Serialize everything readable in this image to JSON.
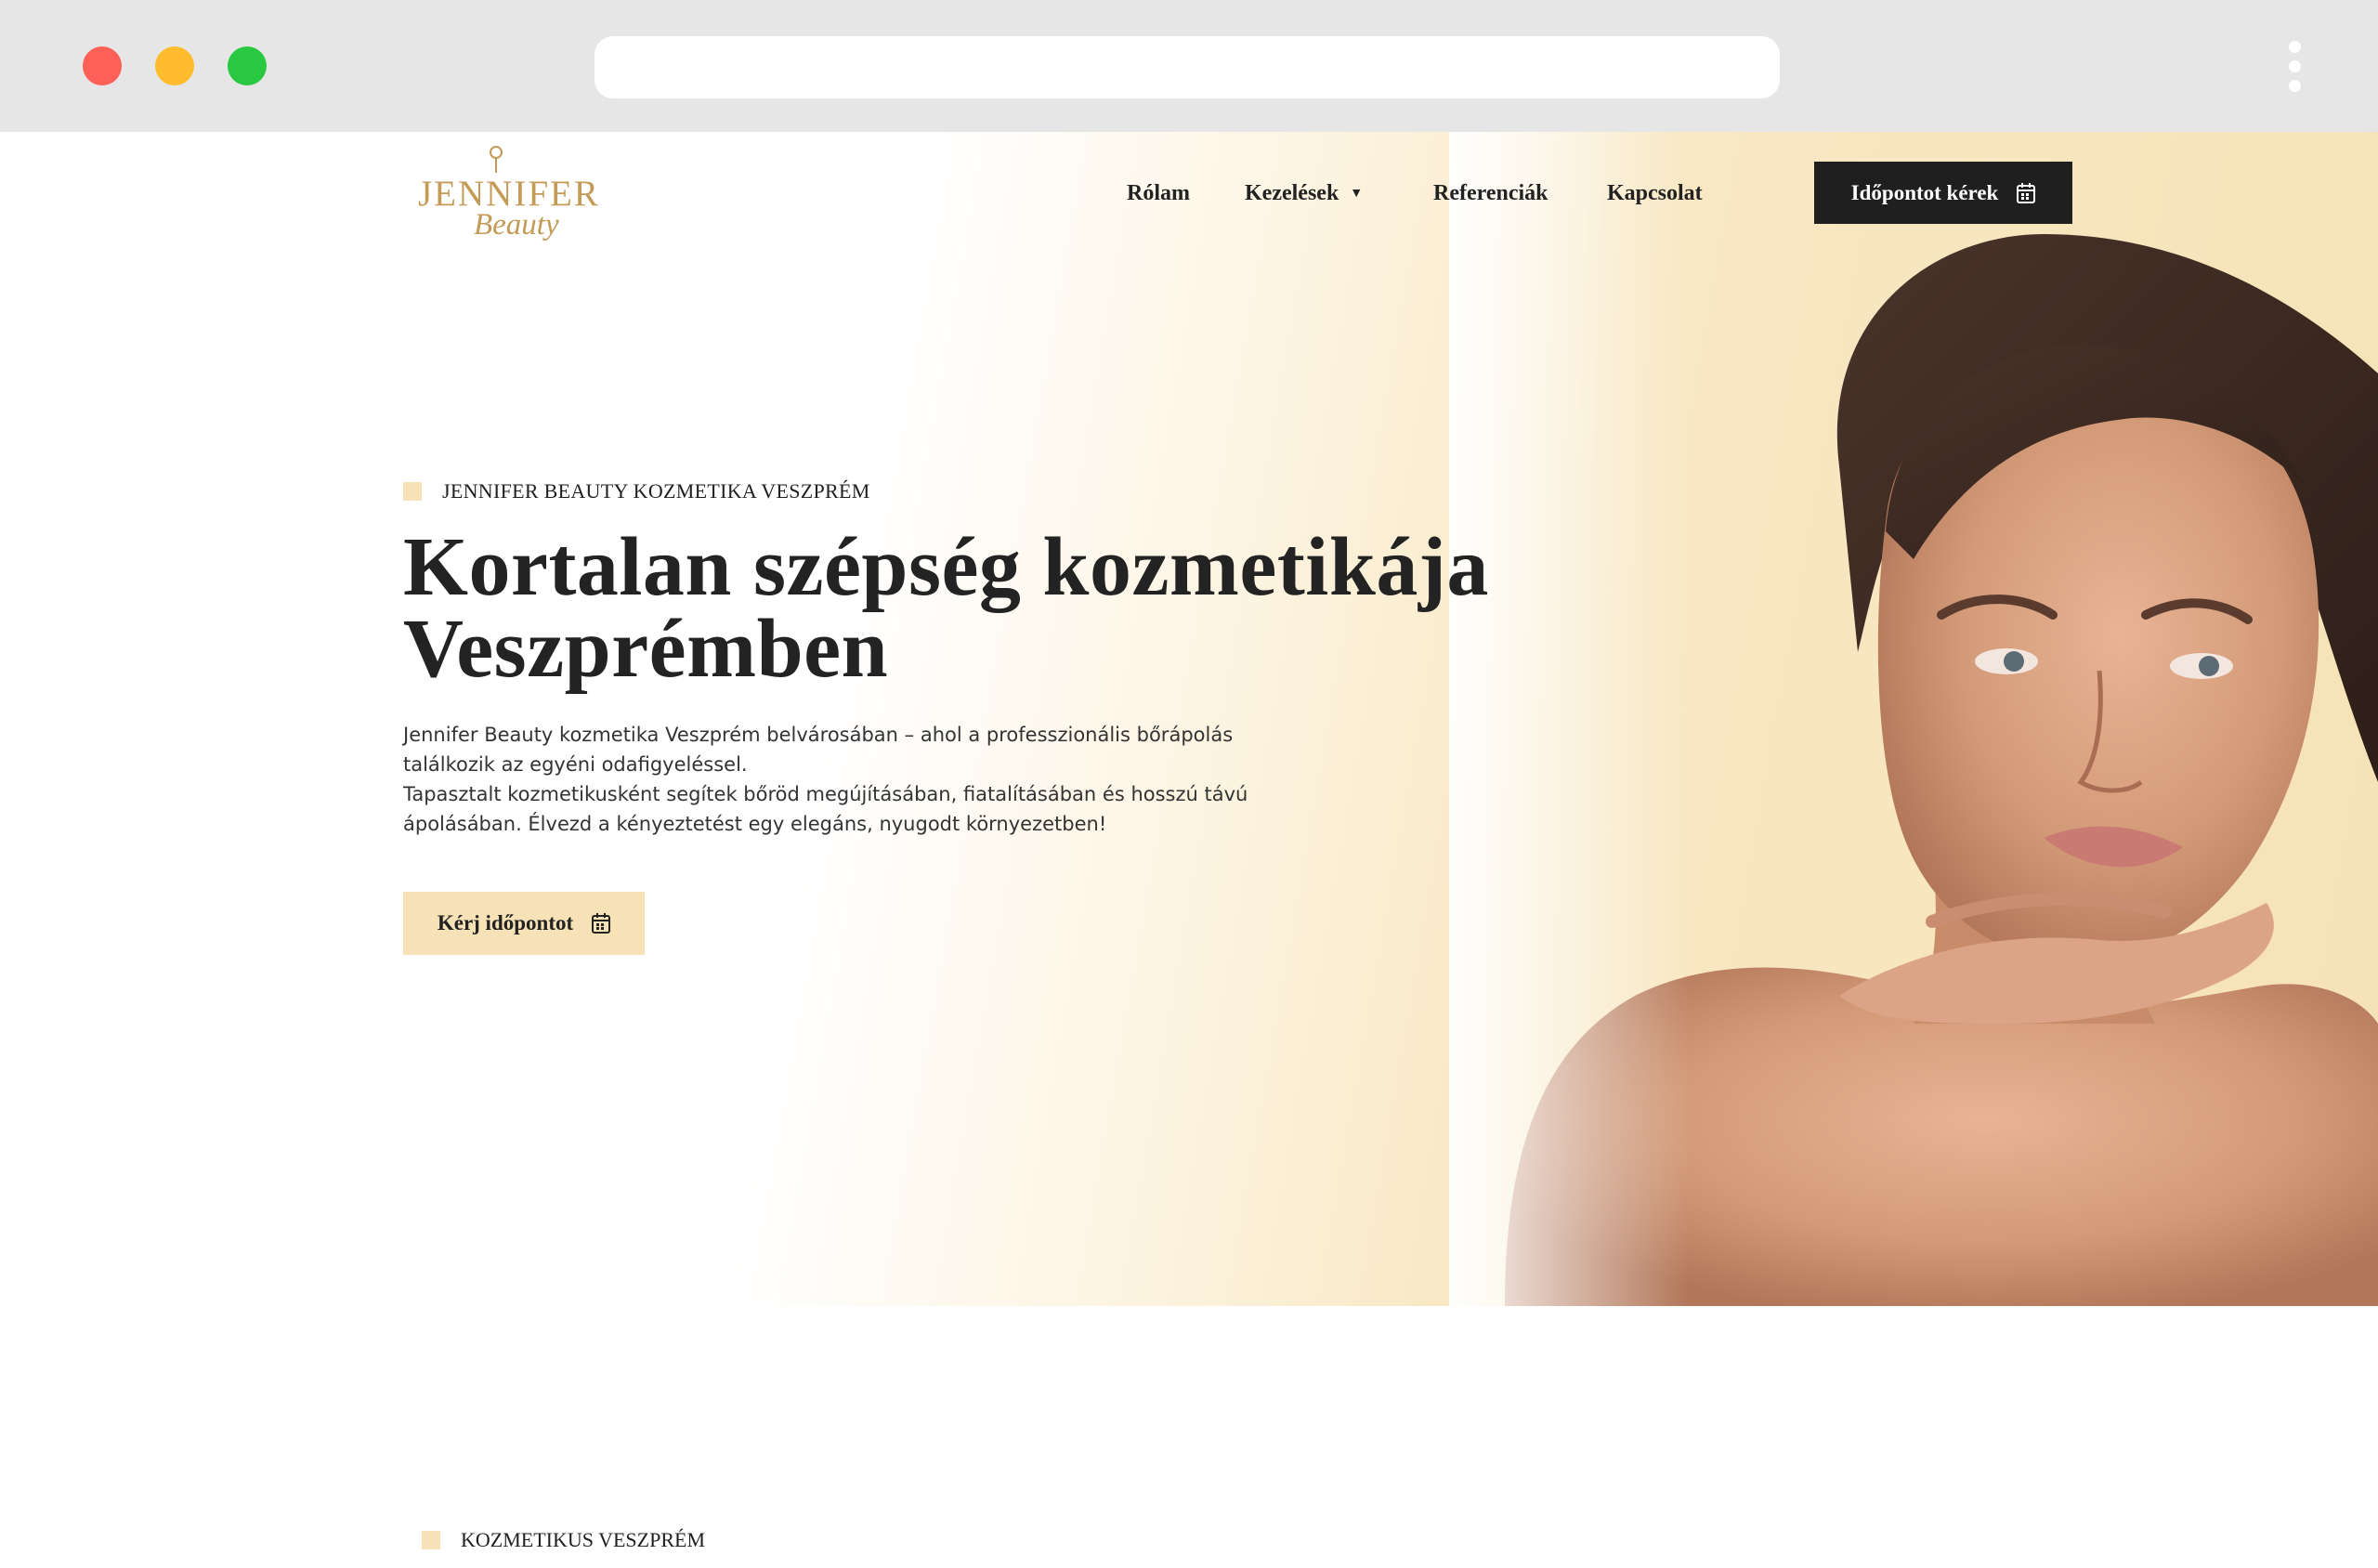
{
  "browser": {
    "icons": {
      "menu": "kebab-menu-icon"
    }
  },
  "brand": {
    "logo_top": "JENNIFER",
    "logo_bottom": "Beauty",
    "colors": {
      "gold": "#c49a57",
      "cream": "#f6e2b6",
      "dark": "#1f1f1f"
    }
  },
  "nav": {
    "items": [
      {
        "label": "Rólam"
      },
      {
        "label": "Kezelések",
        "has_dropdown": true
      },
      {
        "label": "Referenciák"
      },
      {
        "label": "Kapcsolat"
      }
    ],
    "cta_label": "Időpontot kérek",
    "cta_icon": "calendar-icon"
  },
  "hero": {
    "eyebrow": "JENNIFER BEAUTY KOZMETIKA VESZPRÉM",
    "title_line1": "Kortalan szépség kozmetikája",
    "title_line2": "Veszprémben",
    "desc_line1": "Jennifer Beauty kozmetika Veszprém belvárosában – ahol a professzionális bőrápolás",
    "desc_line2": "találkozik az egyéni odafigyeléssel.",
    "desc_line3": "Tapasztalt kozmetikusként segítek bőröd megújításában, fiatalításában és hosszú távú",
    "desc_line4": "ápolásában. Élvezd a kényeztetést egy elegáns, nyugodt környezetben!",
    "cta_label": "Kérj időpontot",
    "cta_icon": "calendar-icon",
    "image": "woman-portrait-image"
  },
  "section2": {
    "eyebrow": "KOZMETIKUS VESZPRÉM"
  }
}
